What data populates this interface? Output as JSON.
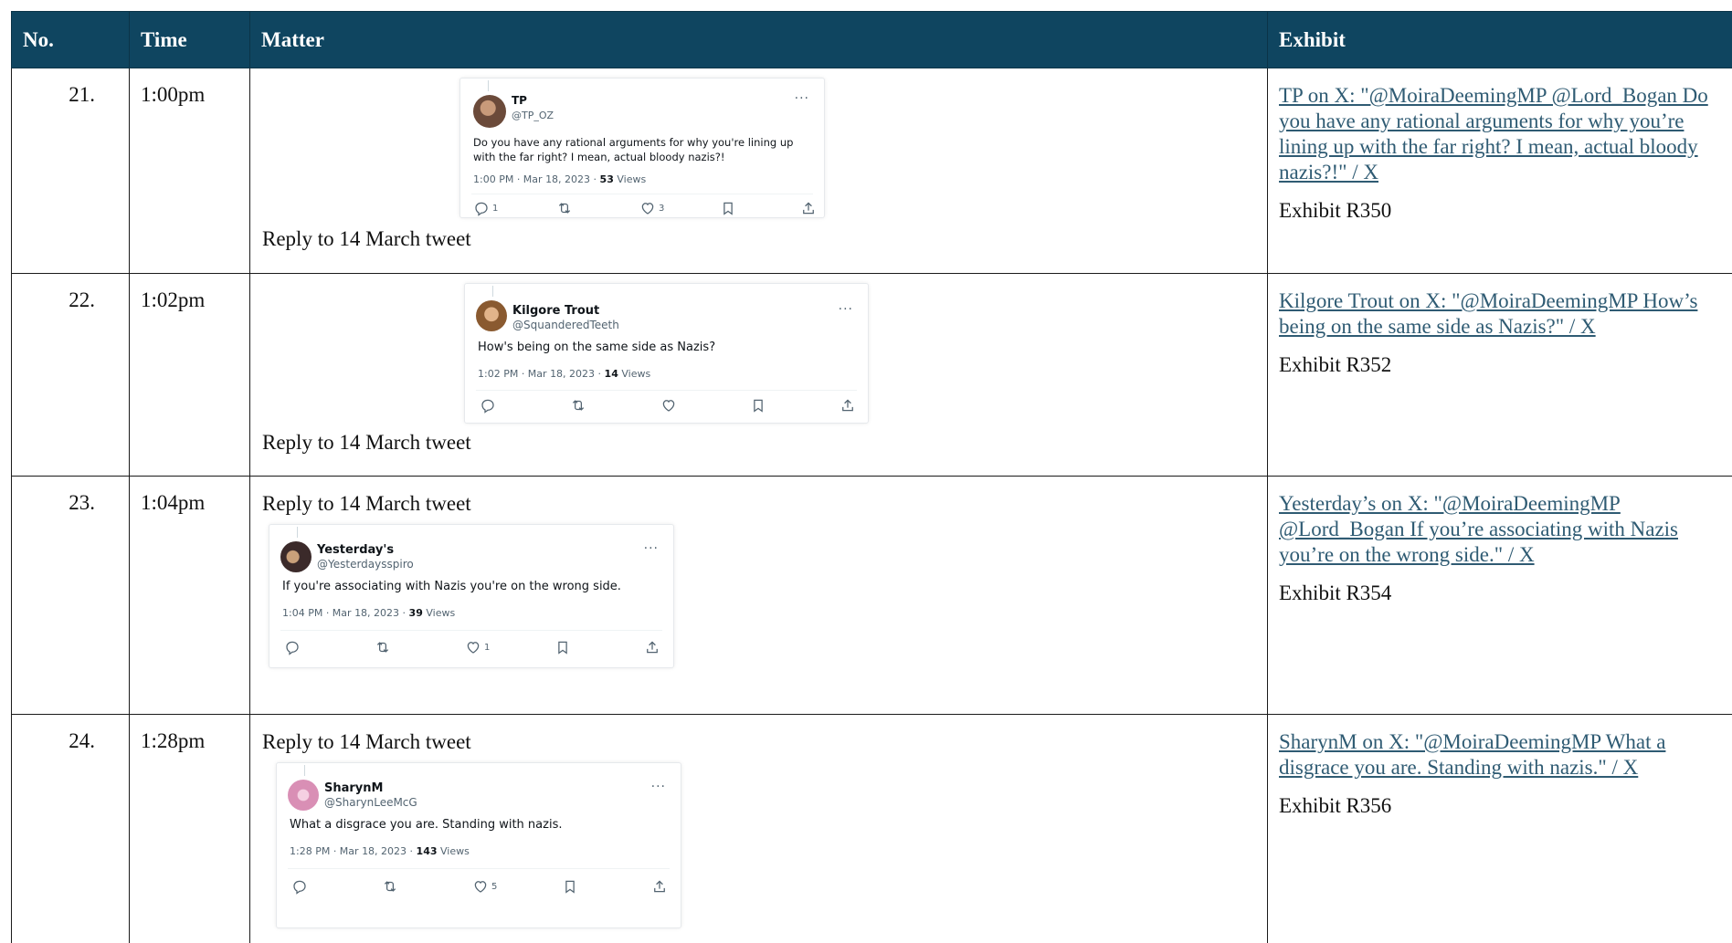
{
  "headers": {
    "no": "No.",
    "time": "Time",
    "matter": "Matter",
    "exhibit": "Exhibit"
  },
  "rows": [
    {
      "no": "21.",
      "time": "1:00pm",
      "matter": "Reply to 14 March tweet",
      "tweet": {
        "name": "TP",
        "handle": "@TP_OZ",
        "text": "Do you have any rational arguments for why you're lining up with the far right? I mean, actual bloody nazis?!",
        "date": "1:00 PM · Mar 18, 2023 · ",
        "views_count": "53",
        "views_label": " Views",
        "reply_count": "1",
        "like_count": "3",
        "avatar_color": "#6b4a3a"
      },
      "exhibit_link": "TP on X: \"@MoiraDeemingMP @Lord_Bogan Do you have any rational arguments for why you’re lining up with the far right? I mean, actual bloody nazis?!\" / X",
      "exhibit_label": "Exhibit R350"
    },
    {
      "no": "22.",
      "time": "1:02pm",
      "matter": "Reply to 14 March tweet",
      "tweet": {
        "name": "Kilgore Trout",
        "handle": "@SquanderedTeeth",
        "text": "How's being on the same side as Nazis?",
        "date": "1:02 PM · Mar 18, 2023 · ",
        "views_count": "14",
        "views_label": " Views",
        "reply_count": "",
        "like_count": "",
        "avatar_color": "#9a6a3c"
      },
      "exhibit_link": "Kilgore Trout on X: \"@MoiraDeemingMP How’s being on the same side as Nazis?\" / X",
      "exhibit_label": "Exhibit R352"
    },
    {
      "no": "23.",
      "time": "1:04pm",
      "matter": "Reply to 14 March tweet",
      "tweet": {
        "name": "Yesterday's",
        "handle": "@Yesterdaysspiro",
        "text": "If you're associating with Nazis you're on the wrong side.",
        "date": "1:04 PM · Mar 18, 2023 · ",
        "views_count": "39",
        "views_label": " Views",
        "reply_count": "",
        "like_count": "1",
        "avatar_color": "#3b2a2a"
      },
      "exhibit_link": "Yesterday’s on X: \"@MoiraDeemingMP @Lord_Bogan If you’re associating with Nazis you’re on the wrong side.\" / X",
      "exhibit_label": "Exhibit R354"
    },
    {
      "no": "24.",
      "time": "1:28pm",
      "matter": "Reply to 14 March tweet",
      "tweet": {
        "name": "SharynM",
        "handle": "@SharynLeeMcG",
        "text": "What a disgrace you are. Standing with nazis.",
        "date": "1:28 PM · Mar 18, 2023 · ",
        "views_count": "143",
        "views_label": " Views",
        "reply_count": "",
        "like_count": "5",
        "avatar_color": "#d98fb5"
      },
      "exhibit_link": "SharynM on X: \"@MoiraDeemingMP What a disgrace you are. Standing with nazis.\" / X",
      "exhibit_label": "Exhibit R356"
    }
  ]
}
